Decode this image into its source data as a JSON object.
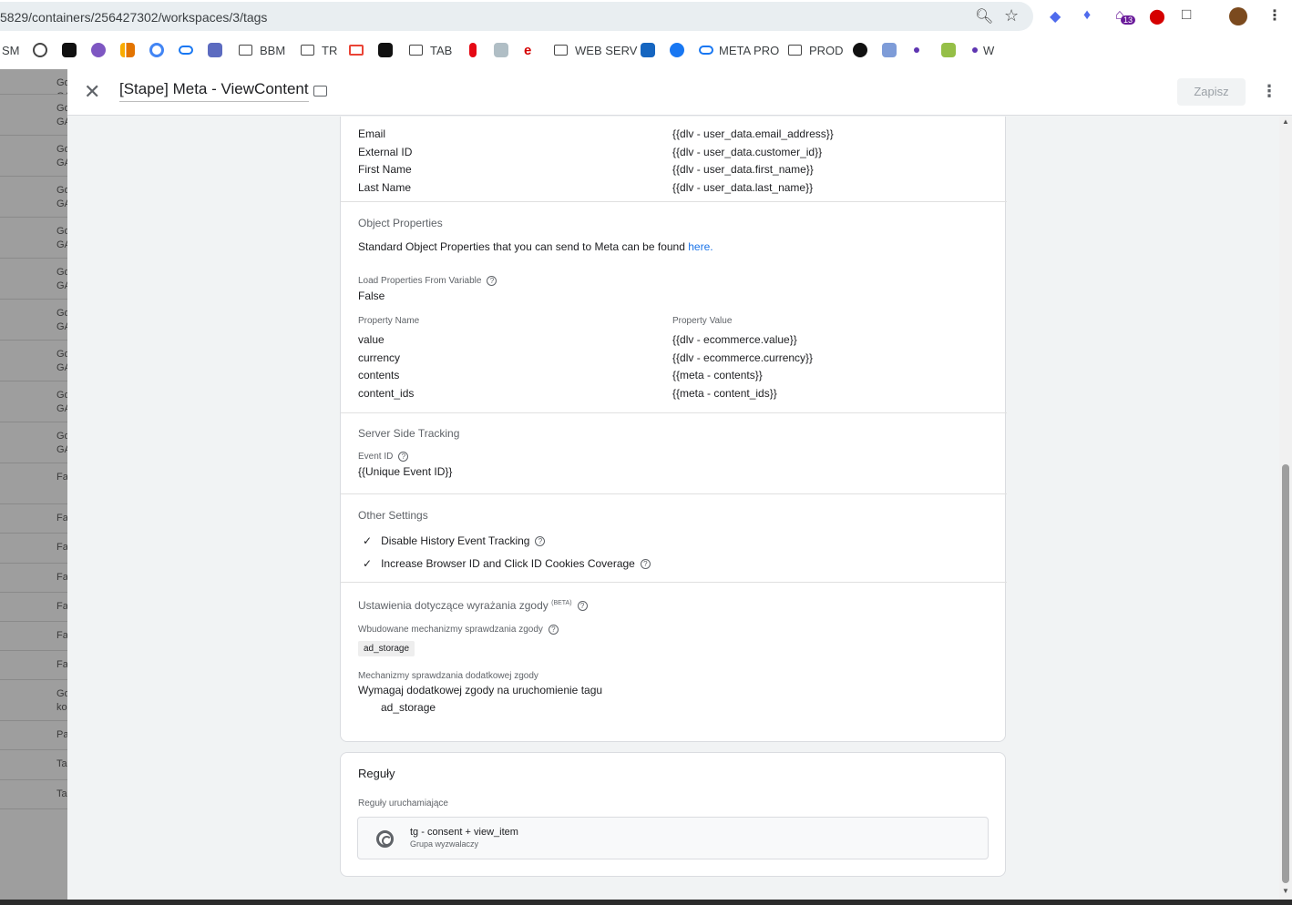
{
  "browser": {
    "url": "5829/containers/256427302/workspaces/3/tags",
    "ext_badge": "13"
  },
  "bookmarks": [
    "SM",
    "BBM",
    "TR",
    "TAB",
    "WEB SERV",
    "META PRO",
    "PROD",
    "W"
  ],
  "background_rows": [
    "Go GA",
    "Go GA",
    "Go GA",
    "Go GA",
    "Go GA",
    "Go GA",
    "Go GA",
    "Go GA",
    "Go GA",
    "Go GA",
    "Fa",
    "Fa",
    "Fa",
    "Fa",
    "Fa",
    "Fa",
    "Fa",
    "Go ko",
    "Pa",
    "Ta",
    "Ta"
  ],
  "panel": {
    "title": "[Stape] Meta - ViewContent",
    "save_label": "Zapisz"
  },
  "user_data": [
    {
      "name": "Email",
      "value": "{{dlv - user_data.email_address}}"
    },
    {
      "name": "External ID",
      "value": "{{dlv - user_data.customer_id}}"
    },
    {
      "name": "First Name",
      "value": "{{dlv - user_data.first_name}}"
    },
    {
      "name": "Last Name",
      "value": "{{dlv - user_data.last_name}}"
    }
  ],
  "object_properties": {
    "heading": "Object Properties",
    "desc": "Standard Object Properties that you can send to Meta can be found ",
    "link": "here",
    "link_suffix": ".",
    "load_label": "Load Properties From Variable",
    "load_value": "False",
    "col_name": "Property Name",
    "col_value": "Property Value",
    "rows": [
      {
        "name": "value",
        "value": "{{dlv - ecommerce.value}}"
      },
      {
        "name": "currency",
        "value": "{{dlv - ecommerce.currency}}"
      },
      {
        "name": "contents",
        "value": "{{meta - contents}}"
      },
      {
        "name": "content_ids",
        "value": "{{meta - content_ids}}"
      }
    ]
  },
  "server_side": {
    "heading": "Server Side Tracking",
    "event_id_label": "Event ID",
    "event_id_value": "{{Unique Event ID}}"
  },
  "other_settings": {
    "heading": "Other Settings",
    "items": [
      "Disable History Event Tracking",
      "Increase Browser ID and Click ID Cookies Coverage"
    ]
  },
  "consent": {
    "heading": "Ustawienia dotyczące wyrażania zgody",
    "beta": "(BETA)",
    "builtin_label": "Wbudowane mechanizmy sprawdzania zgody",
    "builtin_chip": "ad_storage",
    "additional_label": "Mechanizmy sprawdzania dodatkowej zgody",
    "additional_value": "Wymagaj dodatkowej zgody na uruchomienie tagu",
    "additional_item": "ad_storage"
  },
  "rules": {
    "heading": "Reguły",
    "sub": "Reguły uruchamiające",
    "trigger_name": "tg - consent + view_item",
    "trigger_type": "Grupa wyzwalaczy"
  }
}
